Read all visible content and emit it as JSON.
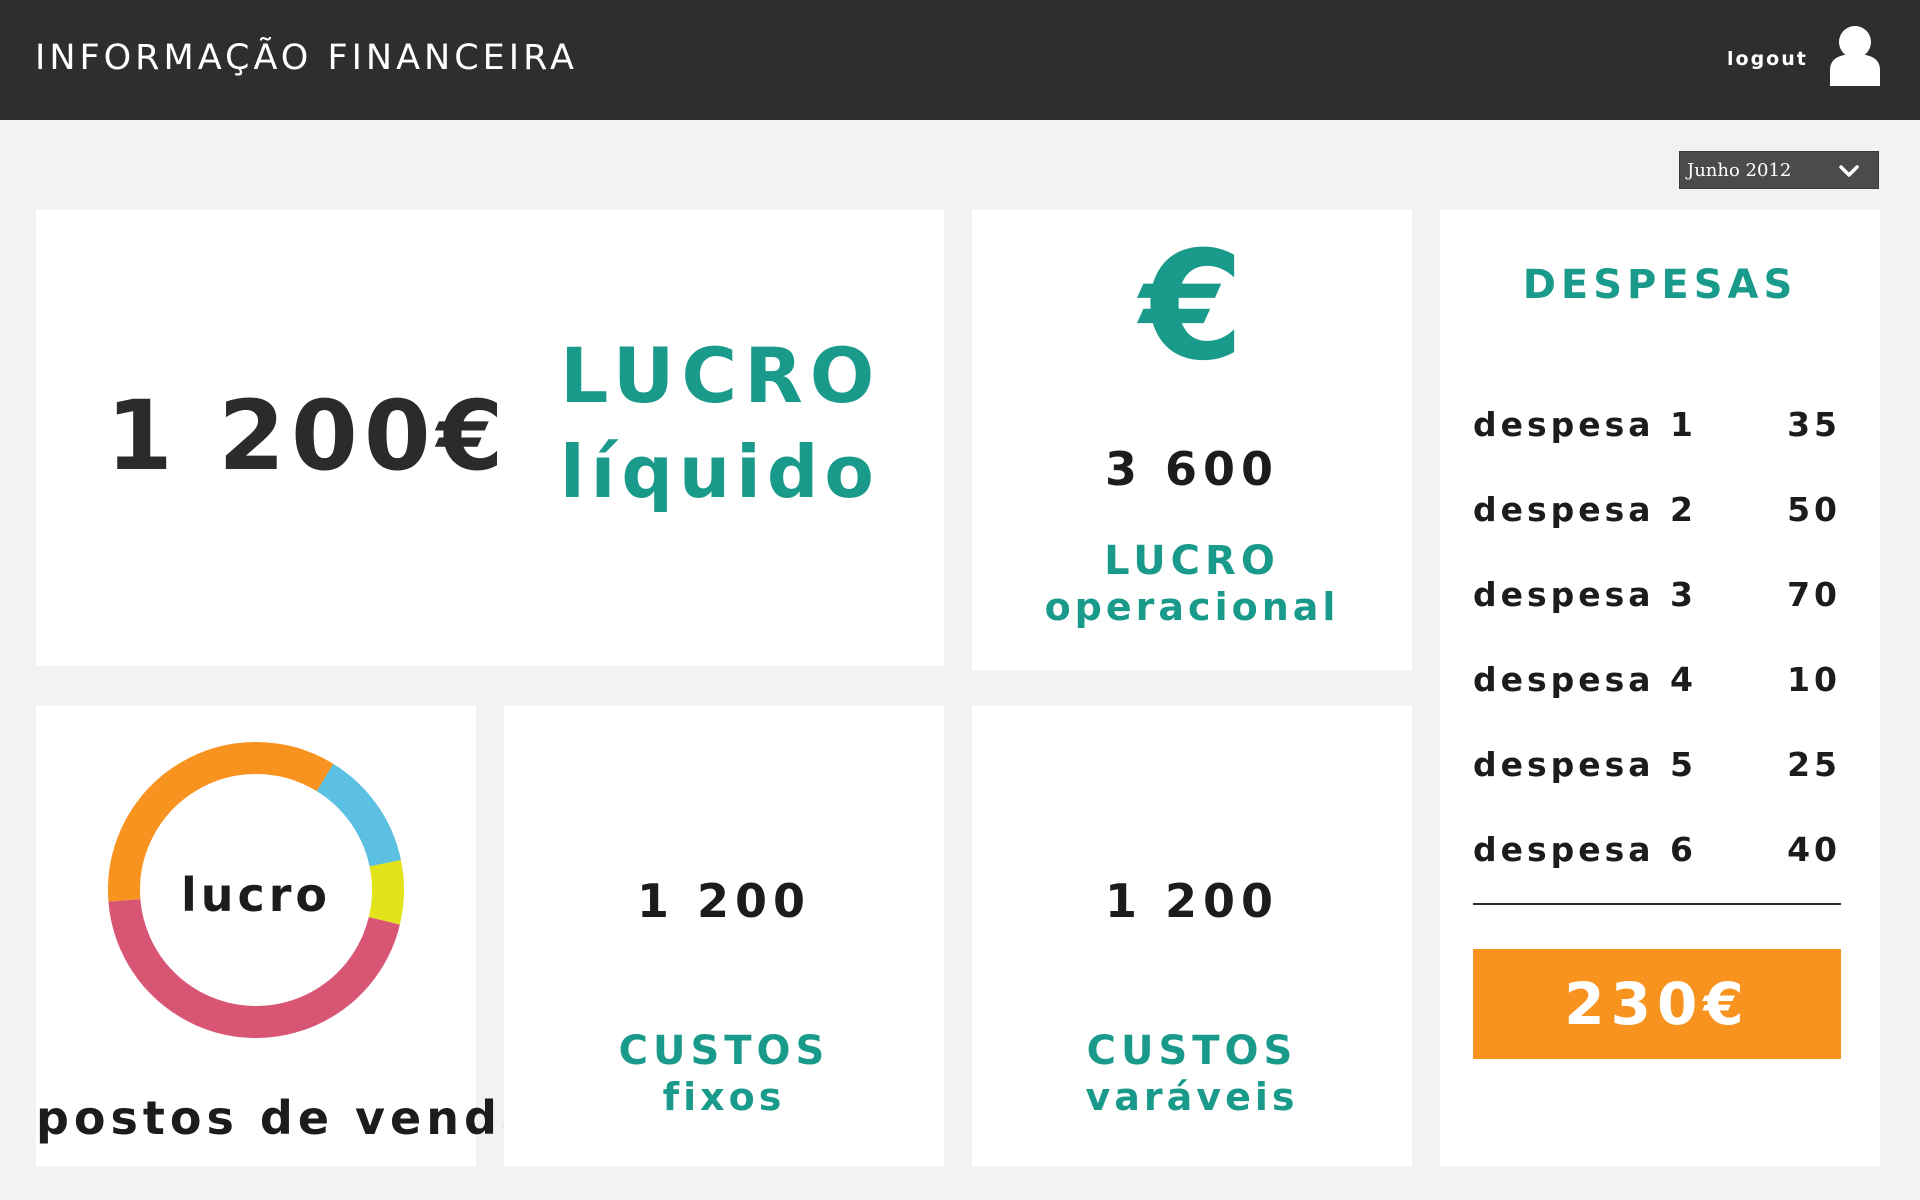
{
  "header": {
    "title": "INFORMAÇÃO FINANCEIRA",
    "logout_label": "logout",
    "user_icon": "user-icon"
  },
  "period_selector": {
    "selected": "Junho 2012",
    "icon": "chevron-down-icon"
  },
  "net_profit": {
    "value": "1 200€",
    "title": "LUCRO",
    "subtitle": "líquido"
  },
  "operating_profit": {
    "icon": "euro-icon",
    "icon_glyph": "€",
    "value": "3 600",
    "title": "LUCRO",
    "subtitle": "operacional"
  },
  "expenses": {
    "title": "DESPESAS",
    "items": [
      {
        "name": "despesa 1",
        "amount": "35"
      },
      {
        "name": "despesa 2",
        "amount": "50"
      },
      {
        "name": "despesa 3",
        "amount": "70"
      },
      {
        "name": "despesa 4",
        "amount": "10"
      },
      {
        "name": "despesa 5",
        "amount": "25"
      },
      {
        "name": "despesa 6",
        "amount": "40"
      }
    ],
    "total": "230€",
    "total_color": "#f7931e"
  },
  "points_of_sale": {
    "center_label": "lucro",
    "caption": "postos de venda",
    "segments": [
      {
        "fraction": 0.13,
        "color": "#5bc0e1"
      },
      {
        "fraction": 0.07,
        "color": "#e3e31b"
      },
      {
        "fraction": 0.45,
        "color": "#d95574"
      },
      {
        "fraction": 0.35,
        "color": "#f7931e"
      }
    ]
  },
  "fixed_costs": {
    "value": "1 200",
    "title": "CUSTOS",
    "subtitle": "fixos"
  },
  "variable_costs": {
    "value": "1 200",
    "title": "CUSTOS",
    "subtitle": "varáveis"
  },
  "colors": {
    "accent": "#1a9a8a",
    "header_bg": "#2d2e2d",
    "page_bg": "#f2f2f2"
  }
}
